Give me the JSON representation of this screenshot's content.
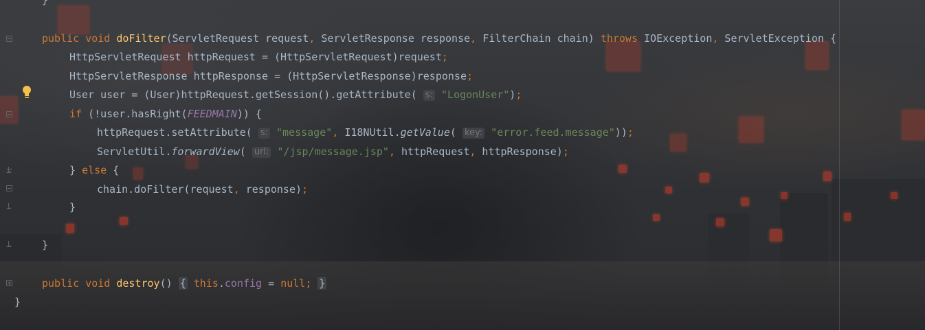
{
  "editor": {
    "lines": {
      "l0": {
        "brace": "}"
      },
      "l1": {
        "kw_public": "public",
        "kw_void": "void",
        "method": "doFilter",
        "p_open": "(ServletRequest request",
        "comma1": ",",
        "p2": " ServletResponse response",
        "comma2": ",",
        "p3": " FilterChain chain) ",
        "kw_throws": "throws",
        "ex1": " IOException",
        "comma3": ",",
        "ex2": " ServletException {"
      },
      "l2": {
        "text": "HttpServletRequest httpRequest = (HttpServletRequest)request",
        "semi": ";"
      },
      "l3": {
        "text": "HttpServletResponse httpResponse = (HttpServletResponse)response",
        "semi": ";"
      },
      "l4": {
        "pre": "User user = (User)httpRequest.getSession().getAttribute(",
        "hint": "s:",
        "str": "\"LogonUser\"",
        "post": ")",
        "semi": ";"
      },
      "l5": {
        "kw_if": "if",
        "pre": " (!user.hasRight(",
        "const": "FEEDMAIN",
        "post": ")) {"
      },
      "l6": {
        "pre": "httpRequest.setAttribute(",
        "hint1": "s:",
        "str1": "\"message\"",
        "comma": ",",
        "mid": " I18NUtil.",
        "fn": "getValue",
        "paren": "(",
        "hint2": "key:",
        "str2": "\"error.feed.message\"",
        "post": "))",
        "semi": ";"
      },
      "l7": {
        "pre": "ServletUtil.",
        "fn": "forwardView",
        "paren": "(",
        "hint": "url:",
        "str": "\"/jsp/message.jsp\"",
        "comma1": ",",
        "mid": " httpRequest",
        "comma2": ",",
        "post": " httpResponse)",
        "semi": ";"
      },
      "l8": {
        "pre": "} ",
        "kw_else": "else",
        "post": " {"
      },
      "l9": {
        "pre": "chain.doFilter(request",
        "comma": ",",
        "post": " response)",
        "semi": ";"
      },
      "l10": {
        "brace": "}"
      },
      "l11": {
        "brace": "}"
      },
      "l12": {
        "kw_public": "public",
        "kw_void": "void",
        "method": "destroy",
        "parens": "()",
        "fold_open": "{",
        "kw_this": "this",
        "dot": ".",
        "field": "config",
        "assign": " = ",
        "kw_null": "null",
        "semi": ";",
        "fold_close": "}"
      },
      "l13": {
        "brace": "}"
      }
    },
    "colors": {
      "keyword": "#cc7832",
      "method": "#ffc66d",
      "string": "#6a8759",
      "constant": "#9876aa",
      "plain": "#a9b7c6",
      "hint": "#787878"
    },
    "icons": [
      "intention-bulb-icon",
      "fold-marker-icon",
      "fold-end-icon",
      "fold-expand-icon"
    ]
  }
}
